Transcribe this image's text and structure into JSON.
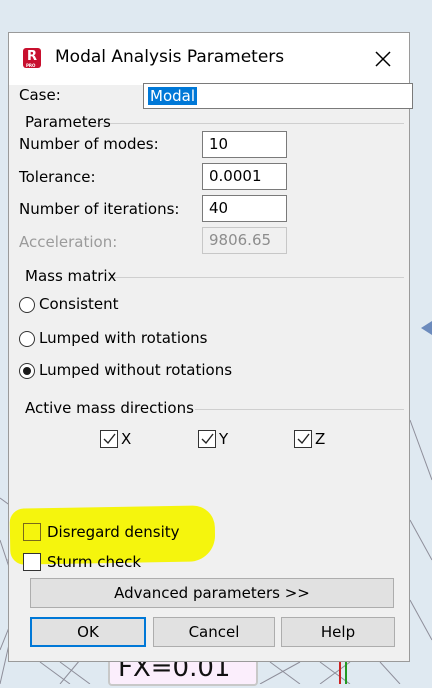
{
  "dialog": {
    "title": "Modal Analysis Parameters",
    "app_icon_letter": "R",
    "app_icon_sub": "PRO",
    "case": {
      "label": "Case:",
      "value": "Modal"
    },
    "parameters": {
      "legend": "Parameters",
      "number_of_modes": {
        "label": "Number of modes:",
        "value": "10"
      },
      "tolerance": {
        "label": "Tolerance:",
        "value": "0.0001"
      },
      "number_of_iterations": {
        "label": "Number of iterations:",
        "value": "40"
      },
      "acceleration": {
        "label": "Acceleration:",
        "value": "9806.65"
      }
    },
    "mass_matrix": {
      "legend": "Mass matrix",
      "options": [
        "Consistent",
        "Lumped with rotations",
        "Lumped without rotations"
      ],
      "selected": "Lumped without rotations"
    },
    "active_mass_directions": {
      "legend": "Active mass directions",
      "x": "X",
      "y": "Y",
      "z": "Z"
    },
    "disregard_density": {
      "label": "Disregard density"
    },
    "sturm_check": {
      "label": "Sturm check"
    },
    "advanced_label": "Advanced parameters >>",
    "ok_label": "OK",
    "cancel_label": "Cancel",
    "help_label": "Help"
  },
  "backdrop": {
    "label": "FX=0.01"
  },
  "colors": {
    "selection": "#0078d7",
    "highlight": "#f5f50d",
    "app_icon": "#c8102e",
    "backdrop_lines": "#8e8e9a"
  }
}
